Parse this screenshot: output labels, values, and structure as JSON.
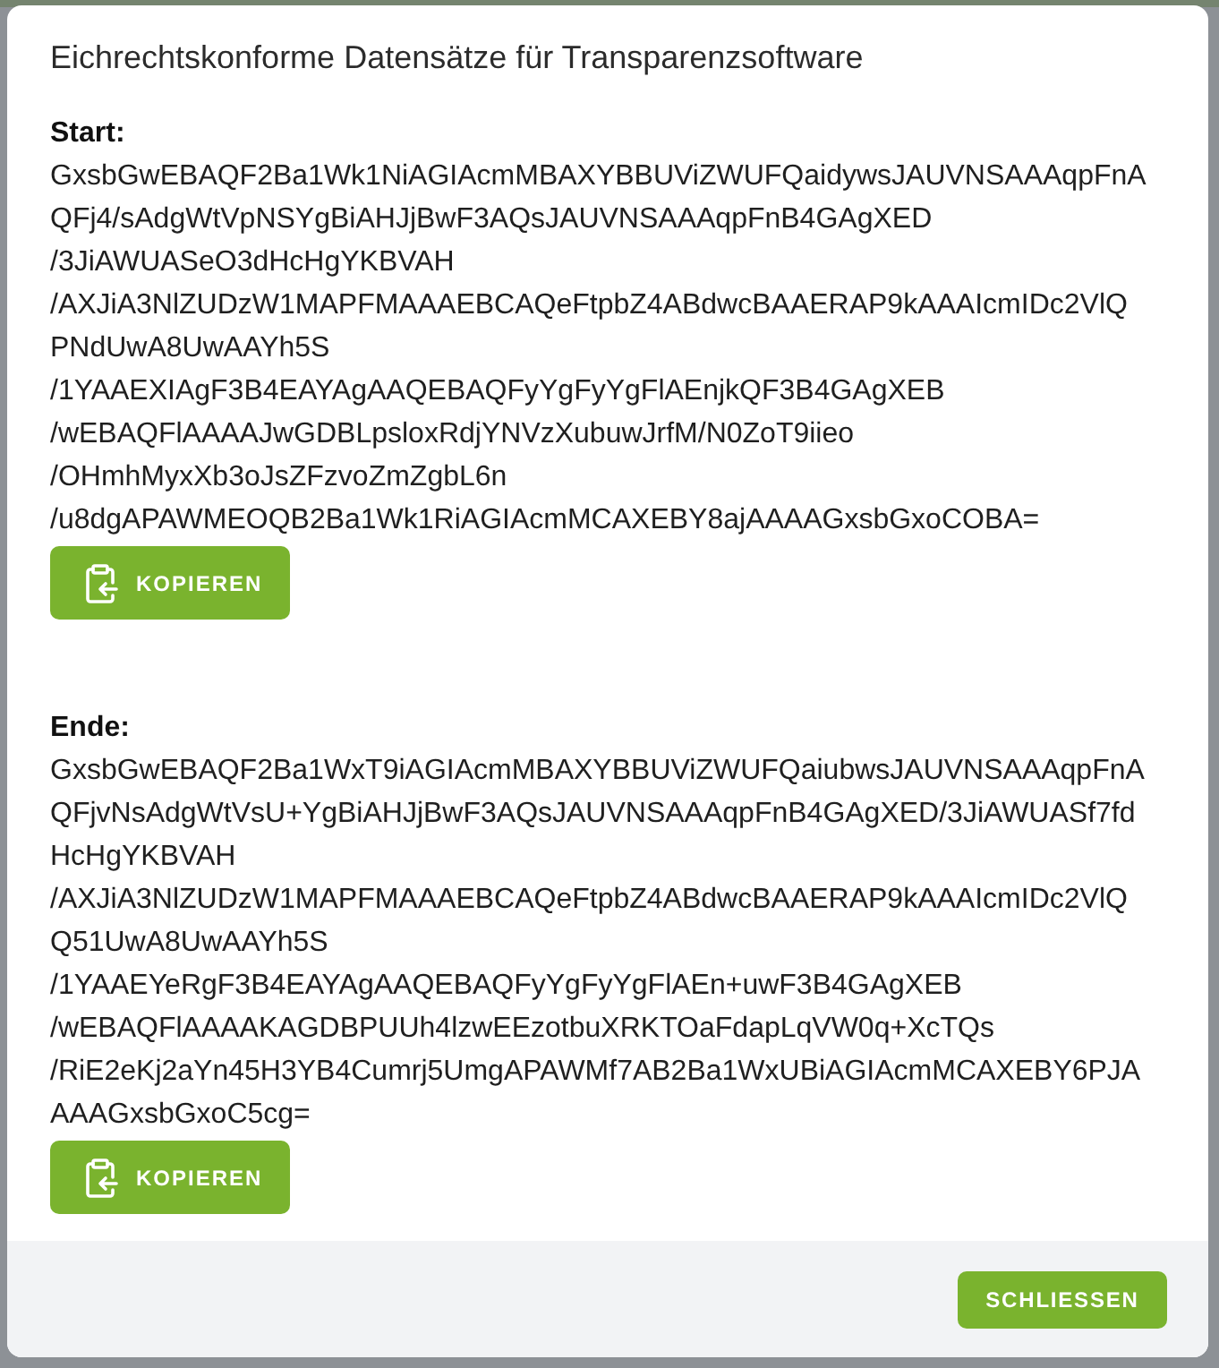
{
  "dialog": {
    "title": "Eichrechtskonforme Datensätze für Transparenzsoftware"
  },
  "sections": [
    {
      "label": "Start:",
      "lines": [
        "GxsbGwEBAQF2Ba1Wk1NiAGIAcmMBAXYBBUViZWUFQaidywsJAUVNSAAAqpFnA",
        "QFj4/sAdgWtVpNSYgBiAHJjBwF3AQsJAUVNSAAAqpFnB4GAgXED",
        "/3JiAWUASeO3dHcHgYKBVAH",
        "/AXJiA3NlZUDzW1MAPFMAAAEBCAQeFtpbZ4ABdwcBAAERAP9kAAAIcmIDc2VlQ",
        "PNdUwA8UwAAYh5S",
        "/1YAAEXIAgF3B4EAYAgAAQEBAQFyYgFyYgFlAEnjkQF3B4GAgXEB",
        "/wEBAQFlAAAAJwGDBLpsloxRdjYNVzXubuwJrfM/N0ZoT9iieo",
        "/OHmhMyxXb3oJsZFzvoZmZgbL6n",
        "/u8dgAPAWMEOQB2Ba1Wk1RiAGIAcmMCAXEBY8ajAAAAGxsbGxoCOBA="
      ],
      "copy_button": "KOPIEREN"
    },
    {
      "label": "Ende:",
      "lines": [
        "GxsbGwEBAQF2Ba1WxT9iAGIAcmMBAXYBBUViZWUFQaiubwsJAUVNSAAAqpFnA",
        "QFjvNsAdgWtVsU+YgBiAHJjBwF3AQsJAUVNSAAAqpFnB4GAgXED/3JiAWUASf7fd",
        "HcHgYKBVAH",
        "/AXJiA3NlZUDzW1MAPFMAAAEBCAQeFtpbZ4ABdwcBAAERAP9kAAAIcmIDc2VlQ",
        "Q51UwA8UwAAYh5S",
        "/1YAAEYeRgF3B4EAYAgAAQEBAQFyYgFyYgFlAEn+uwF3B4GAgXEB",
        "/wEBAQFlAAAAKAGDBPUUh4lzwEEzotbuXRKTOaFdapLqVW0q+XcTQs",
        "/RiE2eKj2aYn45H3YB4Cumrj5UmgAPAWMf7AB2Ba1WxUBiAGIAcmMCAXEBY6PJA",
        "AAAGxsbGxoC5cg="
      ],
      "copy_button": "KOPIEREN"
    }
  ],
  "footer": {
    "close_button": "SCHLIESSEN"
  }
}
